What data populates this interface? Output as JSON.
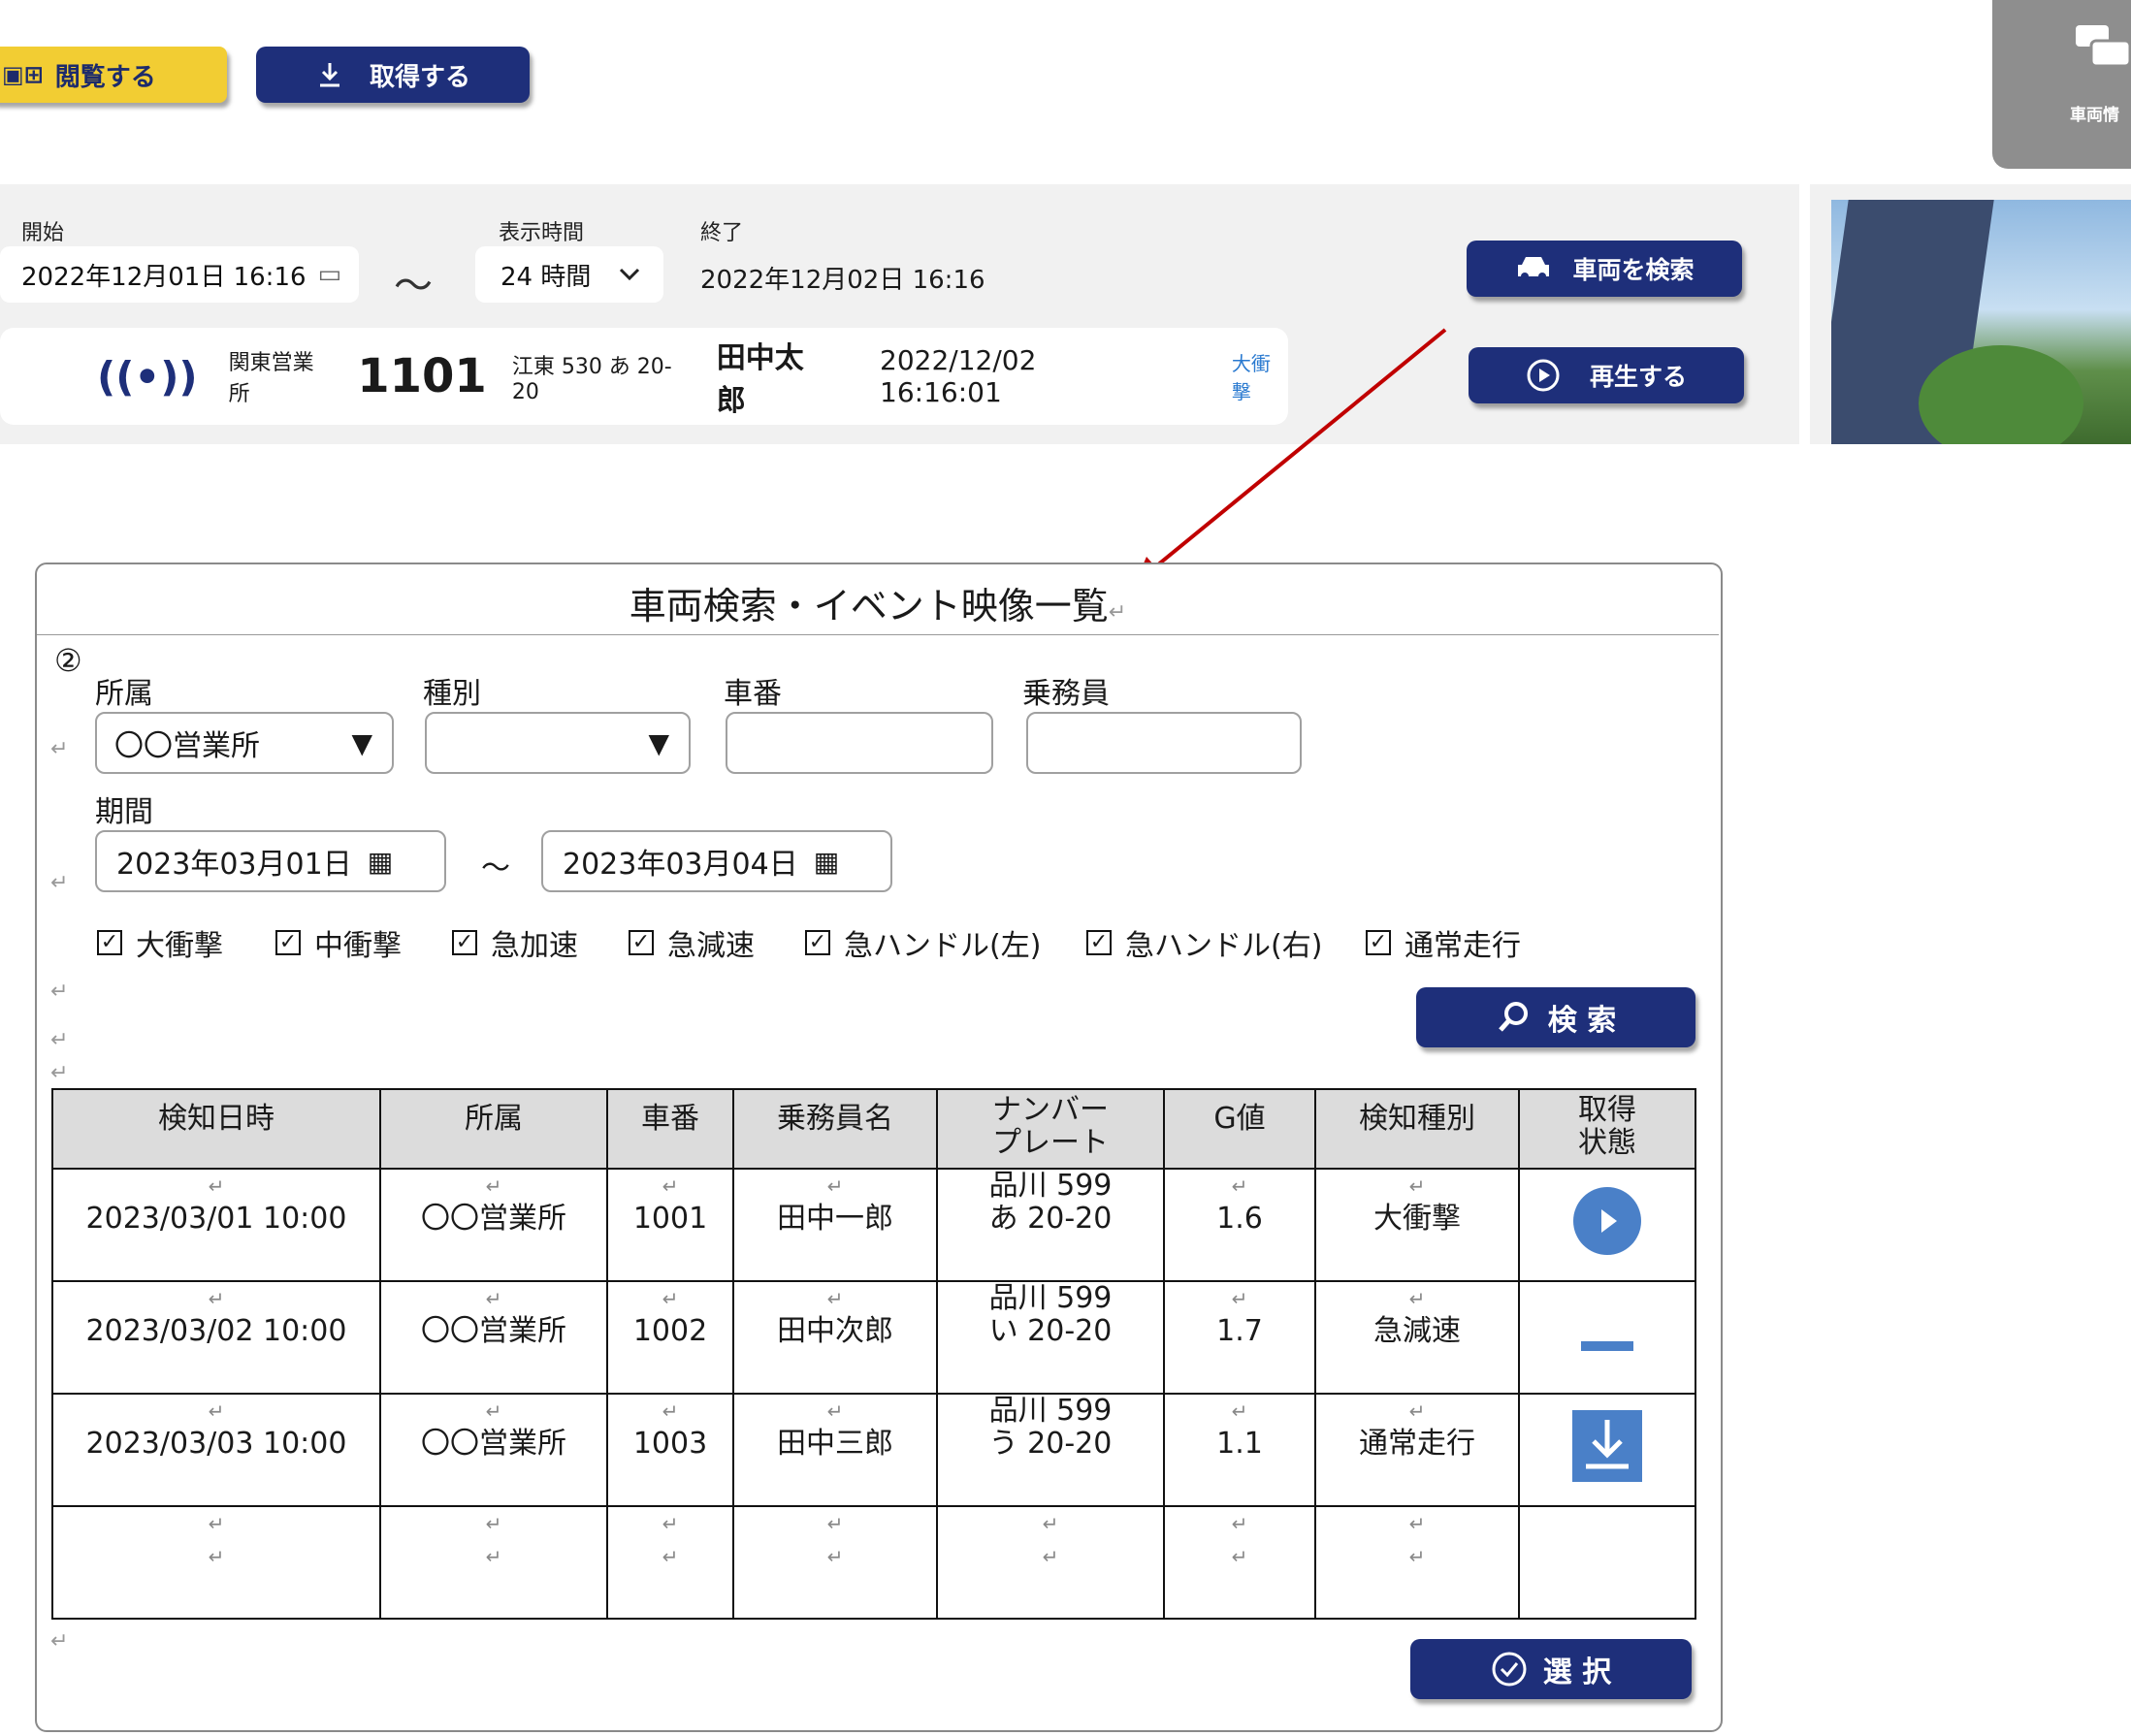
{
  "toolbar": {
    "view_label": "閲覧する",
    "fetch_label": "取得する",
    "vehicle_info_label": "車両情"
  },
  "filter": {
    "start_label": "開始",
    "start_value": "2022年12月01日 16:16",
    "display_time_label": "表示時間",
    "display_time_value": "24 時間",
    "end_label": "終了",
    "end_value": "2022年12月02日 16:16",
    "tilde": "〜",
    "search_vehicle_label": "車両を検索",
    "play_label": "再生する"
  },
  "info_card": {
    "office": "関東営業所",
    "vehicle_no": "1101",
    "plate": "江東 530 あ 20-20",
    "driver": "田中太郎",
    "datetime": "2022/12/02 16:16:01",
    "event": "大衝撃"
  },
  "dialog": {
    "title": "車両検索・イベント映像一覧",
    "step_marker": "②",
    "affiliation_label": "所属",
    "affiliation_value": "〇〇営業所",
    "type_label": "種別",
    "type_value": "",
    "vehicle_no_label": "車番",
    "crew_label": "乗務員",
    "period_label": "期間",
    "period_start": "2023年03月01日",
    "period_tilde": "〜",
    "period_end": "2023年03月04日",
    "checkboxes": [
      "大衝撃",
      "中衝撃",
      "急加速",
      "急減速",
      "急ハンドル(左)",
      "急ハンドル(右)",
      "通常走行"
    ],
    "search_label": "検 索",
    "select_label": "選 択",
    "return_mark": "↵"
  },
  "table": {
    "headers": [
      "検知日時",
      "所属",
      "車番",
      "乗務員名",
      "ナンバー",
      "プレート",
      "G値",
      "検知種別",
      "取得",
      "状態"
    ],
    "rows": [
      {
        "datetime": "2023/03/01 10:00",
        "office": "〇〇営業所",
        "vehicle": "1001",
        "driver": "田中一郎",
        "plate1": "品川 599",
        "plate2": "あ 20-20",
        "g": "1.6",
        "kind": "大衝撃",
        "status": "play-icon"
      },
      {
        "datetime": "2023/03/02 10:00",
        "office": "〇〇営業所",
        "vehicle": "1002",
        "driver": "田中次郎",
        "plate1": "品川 599",
        "plate2": "い 20-20",
        "g": "1.7",
        "kind": "急減速",
        "status": "dash-icon"
      },
      {
        "datetime": "2023/03/03 10:00",
        "office": "〇〇営業所",
        "vehicle": "1003",
        "driver": "田中三郎",
        "plate1": "品川 599",
        "plate2": "う 20-20",
        "g": "1.1",
        "kind": "通常走行",
        "status": "download-icon"
      }
    ]
  },
  "colors": {
    "navy": "#1e2f7a",
    "yellow": "#f2cd33",
    "arrow_red": "#c00000",
    "status_blue": "#4a80c8"
  }
}
